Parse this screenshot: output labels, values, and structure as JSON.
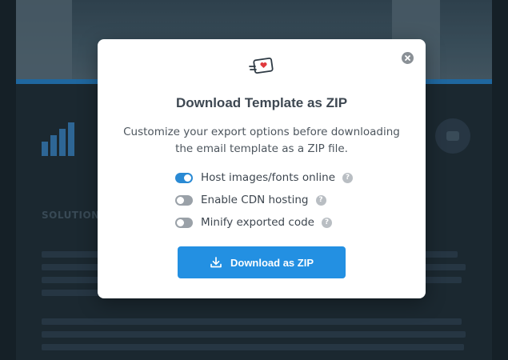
{
  "background": {
    "section_heading": "SOLUTION"
  },
  "modal": {
    "logo": "email-heart-icon",
    "close_icon": "close-icon",
    "title": "Download Template as ZIP",
    "subtitle": "Customize your export options before downloading the email template as a ZIP file.",
    "options": [
      {
        "label": "Host images/fonts online",
        "enabled": true,
        "help": "?"
      },
      {
        "label": "Enable CDN hosting",
        "enabled": false,
        "help": "?"
      },
      {
        "label": "Minify exported code",
        "enabled": false,
        "help": "?"
      }
    ],
    "download_button": {
      "label": "Download as ZIP",
      "icon": "download-icon"
    }
  },
  "colors": {
    "accent": "#2390e2",
    "toggle_on": "#2a8ad4",
    "toggle_off": "#9aa1a8",
    "logo_heart": "#e0393e"
  }
}
